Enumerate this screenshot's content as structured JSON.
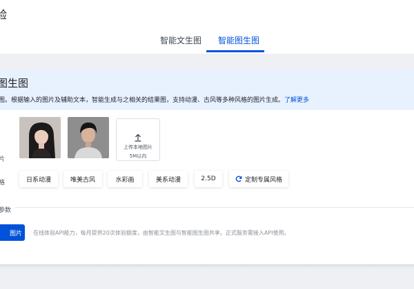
{
  "page": {
    "title": "验"
  },
  "tabs": [
    {
      "label": "智能文生图",
      "active": false
    },
    {
      "label": "智能图生图",
      "active": true
    }
  ],
  "intro": {
    "title": "图生图",
    "description": "图。根据输入的图片及辅助文本，智能生成与之相关的结果图，支持动漫、古风等多种风格的图片生成。",
    "link": "了解更多"
  },
  "labels": {
    "image": "片",
    "style": "格",
    "params": "参数"
  },
  "samples": [
    {
      "icon": "sample-portrait-woman"
    },
    {
      "icon": "sample-portrait-man"
    }
  ],
  "upload": {
    "label": "上传本地图片",
    "hint": "5M以内",
    "icon": "upload-arrow-icon"
  },
  "styles": [
    "日系动漫",
    "唯美古风",
    "水彩画",
    "美系动漫",
    "2.5D"
  ],
  "custom_style": {
    "label": "定制专属风格",
    "icon": "refresh-icon"
  },
  "generate": {
    "label": "图片"
  },
  "footer": {
    "note": "在线体验API能力，每月提供20次体验额度，由智能文生图与智能图生图共享。正式服务需接入API使用。"
  },
  "colors": {
    "accent": "#0052d9",
    "intro_bg": "#e8f1fe",
    "page_bg": "#eef0f4"
  }
}
